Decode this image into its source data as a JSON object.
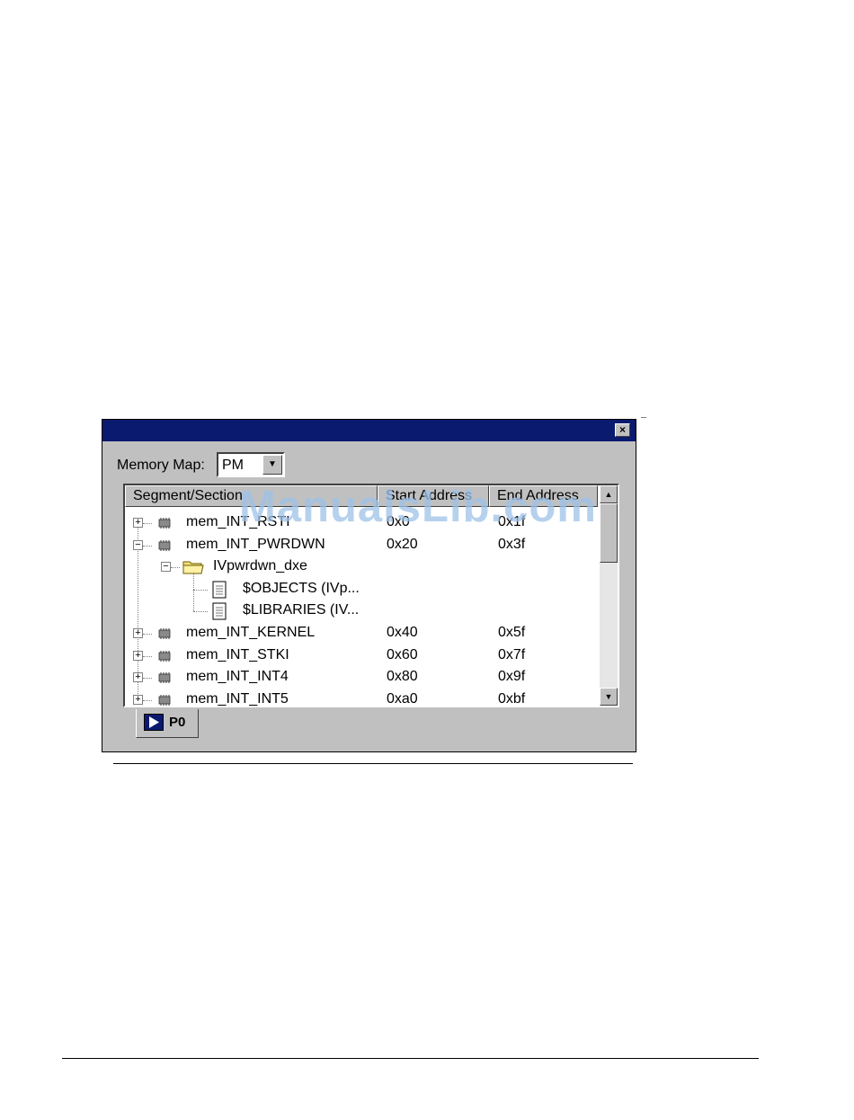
{
  "window": {
    "close_glyph": "×"
  },
  "memory_map": {
    "label": "Memory Map:",
    "value": "PM"
  },
  "columns": [
    "Segment/Section",
    "Start Address",
    "End Address"
  ],
  "rows": [
    {
      "name": "mem_INT_RSTI",
      "start": "0x0",
      "end": "0x1f",
      "level": 0,
      "expanded": false,
      "icon": "chip-icon"
    },
    {
      "name": "mem_INT_PWRDWN",
      "start": "0x20",
      "end": "0x3f",
      "level": 0,
      "expanded": true,
      "icon": "chip-icon"
    },
    {
      "name": "IVpwrdwn_dxe",
      "start": "",
      "end": "",
      "level": 1,
      "expanded": true,
      "icon": "folder-icon"
    },
    {
      "name": "$OBJECTS (IVp...",
      "start": "",
      "end": "",
      "level": 2,
      "icon": "document-icon"
    },
    {
      "name": "$LIBRARIES (IV...",
      "start": "",
      "end": "",
      "level": 2,
      "icon": "document-icon"
    },
    {
      "name": "mem_INT_KERNEL",
      "start": "0x40",
      "end": "0x5f",
      "level": 0,
      "expanded": false,
      "icon": "chip-icon"
    },
    {
      "name": "mem_INT_STKI",
      "start": "0x60",
      "end": "0x7f",
      "level": 0,
      "expanded": false,
      "icon": "chip-icon"
    },
    {
      "name": "mem_INT_INT4",
      "start": "0x80",
      "end": "0x9f",
      "level": 0,
      "expanded": false,
      "icon": "chip-icon"
    },
    {
      "name": "mem_INT_INT5",
      "start": "0xa0",
      "end": "0xbf",
      "level": 0,
      "expanded": false,
      "icon": "chip-icon"
    }
  ],
  "tab": {
    "label": "P0",
    "icon": "play-icon"
  },
  "watermark": "ManualsLib.com",
  "colors": {
    "titlebar": "#0a1a6e",
    "face": "#c0c0c0",
    "watermark": "#9ec2e8"
  }
}
